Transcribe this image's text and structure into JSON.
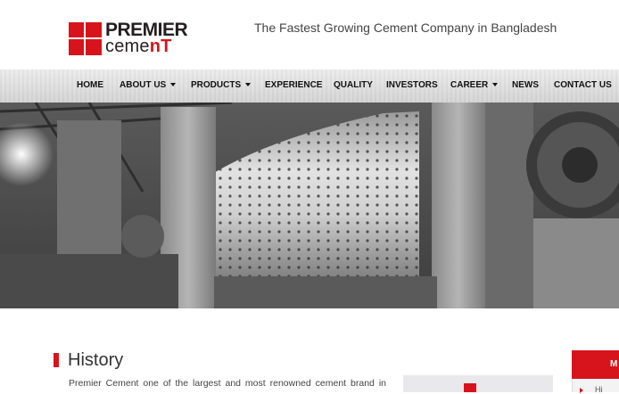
{
  "header": {
    "logo_line1": "PREMIER",
    "logo_line2_a": "ceme",
    "logo_line2_b": "nT",
    "tagline": "The Fastest Growing Cement Company in Bangladesh"
  },
  "nav": {
    "items": [
      {
        "label": "HOME",
        "dropdown": false
      },
      {
        "label": "ABOUT US",
        "dropdown": true
      },
      {
        "label": "PRODUCTS",
        "dropdown": true
      },
      {
        "label": "EXPERIENCE",
        "dropdown": false
      },
      {
        "label": "QUALITY",
        "dropdown": false
      },
      {
        "label": "INVESTORS",
        "dropdown": false
      },
      {
        "label": "CAREER",
        "dropdown": true
      },
      {
        "label": "NEWS",
        "dropdown": false
      },
      {
        "label": "CONTACT US",
        "dropdown": false
      }
    ]
  },
  "content": {
    "section_title": "History",
    "intro_text": "Premier Cement one of the largest and most renowned cement brand in"
  },
  "sidebar": {
    "box_label": "M",
    "item_label": "Hi"
  },
  "colors": {
    "brand_red": "#d7141c",
    "text_dark": "#231f20"
  }
}
